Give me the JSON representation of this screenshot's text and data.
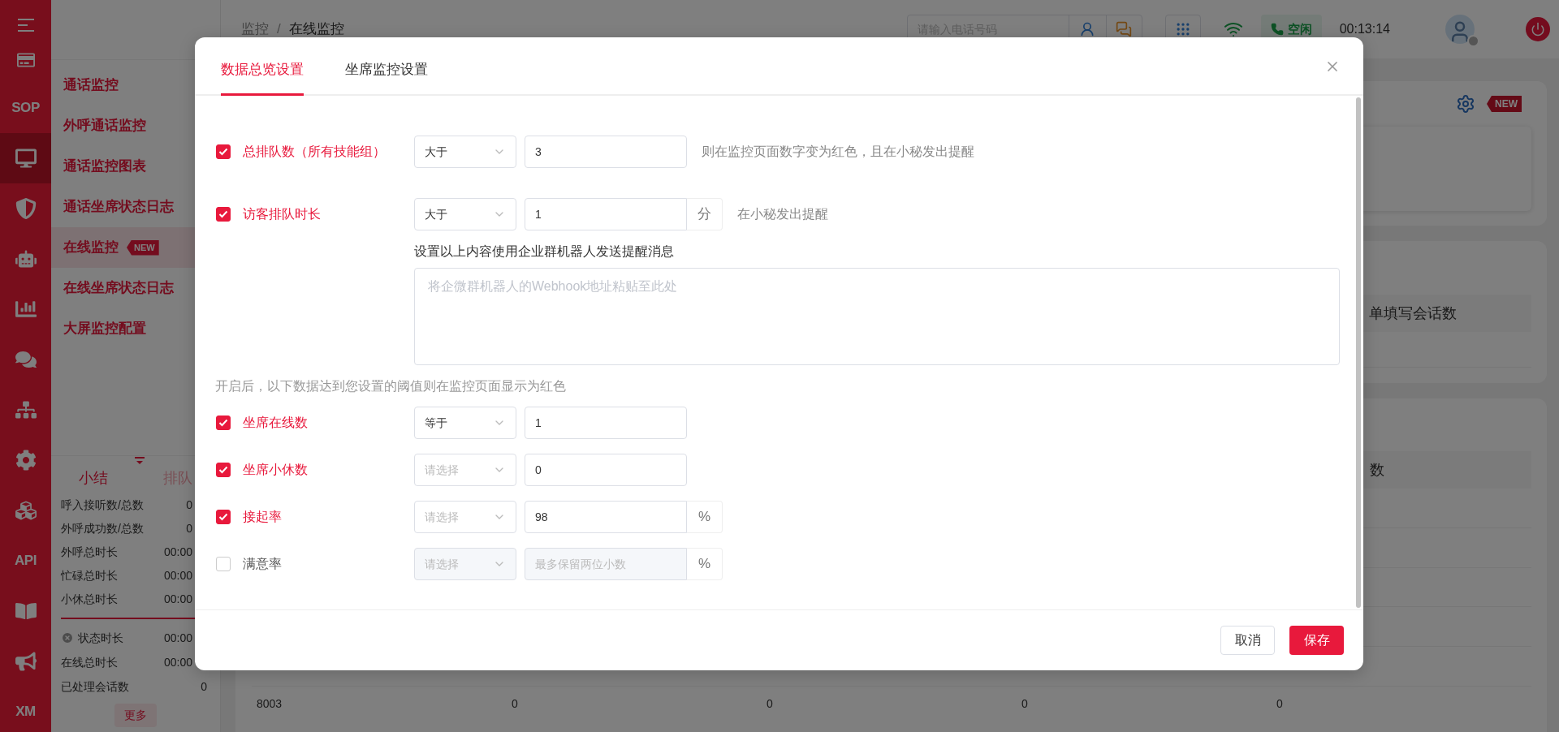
{
  "rail": {
    "items": [
      {
        "selected": false
      },
      {
        "label": "SOP",
        "selected": false
      },
      {
        "selected": true
      },
      {
        "selected": false
      },
      {
        "selected": false
      },
      {
        "selected": false
      },
      {
        "selected": false
      },
      {
        "selected": false
      },
      {
        "selected": false
      },
      {
        "selected": false
      },
      {
        "label": "API",
        "selected": false
      },
      {
        "selected": false
      },
      {
        "selected": false
      },
      {
        "label": "XM",
        "selected": false
      }
    ]
  },
  "submenu": {
    "items": [
      {
        "label": "通话监控",
        "selected": false
      },
      {
        "label": "外呼通话监控",
        "selected": false
      },
      {
        "label": "通话监控图表",
        "selected": false
      },
      {
        "label": "通话坐席状态日志",
        "selected": false
      },
      {
        "label": "在线监控",
        "selected": true,
        "badge": "NEW"
      },
      {
        "label": "在线坐席状态日志",
        "selected": false
      },
      {
        "label": "大屏监控配置",
        "selected": false
      }
    ]
  },
  "summary": {
    "tabs": [
      {
        "label": "小结",
        "selected": true
      },
      {
        "label": "排队",
        "selected": false
      }
    ],
    "stats": [
      {
        "label": "呼入接听数/总数",
        "value": "0"
      },
      {
        "label": "外呼成功数/总数",
        "value": "0"
      },
      {
        "label": "外呼总时长",
        "value": "00:00"
      },
      {
        "label": "忙碌总时长",
        "value": "00:00"
      },
      {
        "label": "小休总时长",
        "value": "00:00"
      }
    ],
    "status_stats": [
      {
        "kind": "closable",
        "label": "状态时长",
        "value": "00:00"
      },
      {
        "kind": "plain",
        "label": "在线总时长",
        "value": "00:00"
      },
      {
        "kind": "plain",
        "label": "已处理会话数",
        "value": "0"
      }
    ],
    "more_button": "更多"
  },
  "topbar": {
    "breadcrumb": [
      "监控",
      "在线监控"
    ],
    "breadcrumb_separator": "/",
    "phone_search": {
      "placeholder": "请输入电话号码"
    },
    "status": "空闲",
    "timer": "00:13:14"
  },
  "background": {
    "settings_badge": "NEW",
    "card_2_header": "单填写会话数",
    "card_3_header": "数",
    "table_row": [
      "8003",
      "0",
      "0",
      "0",
      "0"
    ]
  },
  "modal": {
    "tabs": [
      {
        "label": "数据总览设置",
        "selected": true
      },
      {
        "label": "坐席监控设置",
        "selected": false
      }
    ],
    "alert_rules": [
      {
        "label": "总排队数（所有技能组）",
        "checked": true,
        "operator": "大于",
        "value": "3",
        "hint": "则在监控页面数字变为红色，且在小秘发出提醒"
      },
      {
        "label": "访客排队时长",
        "checked": true,
        "operator": "大于",
        "value": "1",
        "unit": "分",
        "hint": "在小秘发出提醒"
      }
    ],
    "webhook": {
      "label": "设置以上内容使用企业群机器人发送提醒消息",
      "placeholder": "将企微群机器人的Webhook地址粘贴至此处"
    },
    "threshold_note": "开启后，以下数据达到您设置的阈值则在监控页面显示为红色",
    "threshold_rules": [
      {
        "label": "坐席在线数",
        "checked": true,
        "operator": "等于",
        "value": "1"
      },
      {
        "label": "坐席小休数",
        "checked": true,
        "operator_placeholder": "请选择",
        "value": "0"
      },
      {
        "label": "接起率",
        "checked": true,
        "operator_placeholder": "请选择",
        "value": "98",
        "unit": "%"
      },
      {
        "label": "满意率",
        "checked": false,
        "operator_placeholder": "请选择",
        "value_placeholder": "最多保留两位小数",
        "unit": "%"
      }
    ],
    "buttons": {
      "cancel": "取消",
      "save": "保存"
    }
  }
}
